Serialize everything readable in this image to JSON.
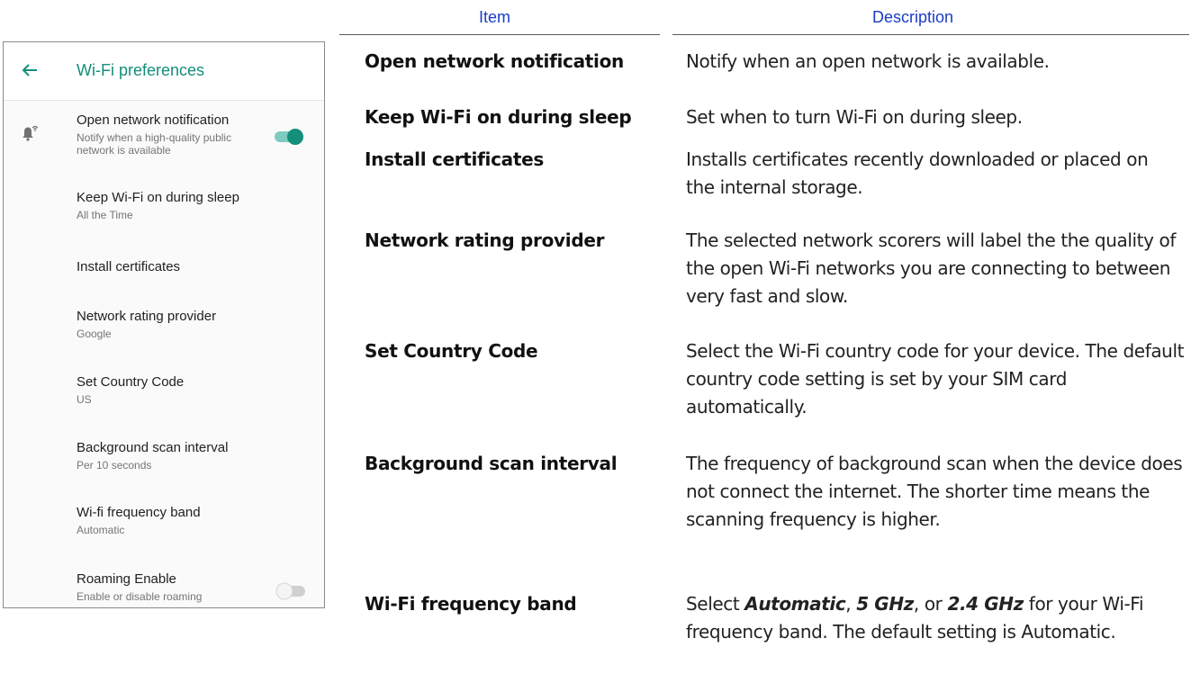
{
  "phone": {
    "title": "Wi-Fi preferences",
    "back_icon": "arrow-left-icon",
    "colors": {
      "accent": "#148f7a",
      "toggle_off": "#bdbdbd"
    },
    "items": [
      {
        "title": "Open network notification",
        "subtitle": "Notify when a high-quality public network is available",
        "toggle": "on",
        "icon": "wifi-notification-bell-icon"
      },
      {
        "title": "Keep Wi-Fi on during sleep",
        "subtitle": "All the Time"
      },
      {
        "title": "Install certificates",
        "subtitle": ""
      },
      {
        "title": "Network rating provider",
        "subtitle": "Google"
      },
      {
        "title": "Set Country Code",
        "subtitle": "US"
      },
      {
        "title": "Background scan interval",
        "subtitle": "Per 10 seconds"
      },
      {
        "title": "Wi-fi frequency band",
        "subtitle": "Automatic"
      },
      {
        "title": "Roaming Enable",
        "subtitle": "Enable or disable roaming",
        "toggle": "off"
      }
    ]
  },
  "table": {
    "header_item": "Item",
    "header_desc": "Description",
    "header_color": "#1a3cc8",
    "rows": [
      {
        "item": "Open network notification",
        "desc": "Notify when an open network is available."
      },
      {
        "item": "Keep Wi-Fi on during sleep",
        "desc": "Set when to turn Wi-Fi on during sleep."
      },
      {
        "item": "Install certificates",
        "desc": "Installs certificates recently downloaded or placed on the internal storage."
      },
      {
        "item": "Network rating provider",
        "desc": "The selected network scorers will label the the quality of the open Wi-Fi networks you are connecting to between very fast and slow."
      },
      {
        "item": "Set Country Code",
        "desc": "Select the Wi-Fi country code for your device. The default country code setting is set by your SIM card automatically."
      },
      {
        "item": "Background scan interval",
        "desc": "The frequency of background scan when the device does not connect the internet. The shorter time means the scanning frequency is higher."
      },
      {
        "item": "Wi-Fi frequency band",
        "desc_parts": [
          "Select ",
          "Automatic",
          ", ",
          "5 GHz",
          ", or ",
          "2.4 GHz",
          " for your Wi-Fi frequency band. The default setting is Automatic."
        ]
      }
    ]
  }
}
